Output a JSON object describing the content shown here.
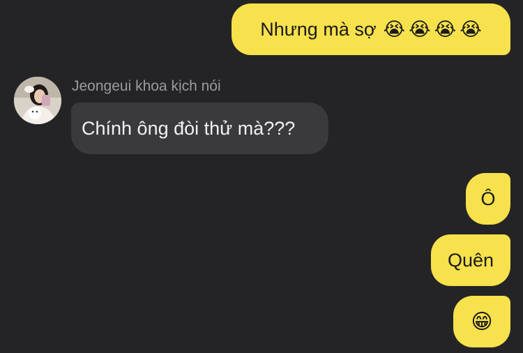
{
  "conversation": {
    "contact_name": "Jeongeui khoa kịch nói",
    "messages": [
      {
        "direction": "outgoing",
        "text": "Nhưng mà sợ",
        "emoji": [
          "😭",
          "😭",
          "😭",
          "😭"
        ]
      },
      {
        "direction": "incoming",
        "text": "Chính ông đòi thử mà???"
      },
      {
        "direction": "outgoing",
        "text": "Ô"
      },
      {
        "direction": "outgoing",
        "text": "Quên"
      },
      {
        "direction": "outgoing",
        "text": "😁"
      }
    ]
  },
  "colors": {
    "background": "#242426",
    "outgoing_bubble": "#f7e14c",
    "incoming_bubble": "#3a3a3c",
    "sender_name": "#9a9aa0"
  },
  "icons": {
    "avatar": "contact-avatar-photo"
  }
}
